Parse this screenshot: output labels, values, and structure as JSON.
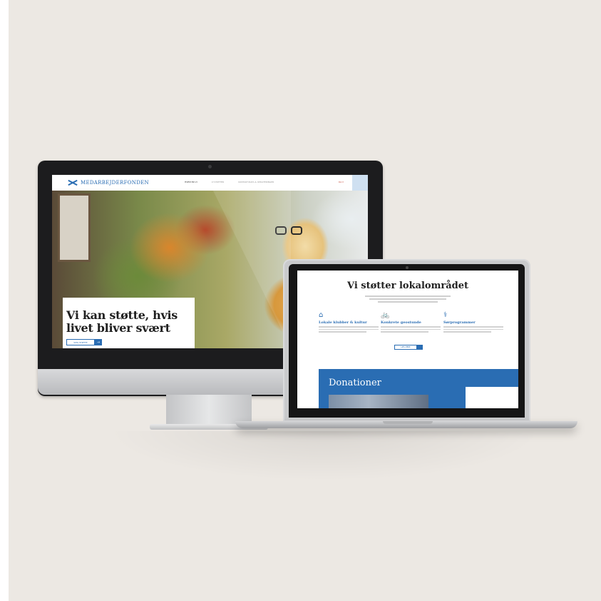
{
  "desktop_site": {
    "logo_text": "MEDARBEJDERFONDEN",
    "nav": {
      "items": [
        "HVEM ER VI",
        "VI STØTTER",
        "KONTAKT/DATA & OPDATERINGER"
      ],
      "language": "DA ▾"
    },
    "hero": {
      "title_line1": "Vi kan støtte, hvis",
      "title_line2": "livet bliver svært",
      "button_label": "SØG STØTTE",
      "button_arrow": "→"
    }
  },
  "laptop_site": {
    "section_title": "Vi støtter lokalområdet",
    "columns": [
      {
        "icon": "⌂",
        "title": "Lokale klubber & kultur"
      },
      {
        "icon": "🚲",
        "title": "Konkrete geostunde"
      },
      {
        "icon": "⚕",
        "title": "Sørprogrammer"
      }
    ],
    "button_label": "LÆS MERE",
    "donations_title": "Donationer"
  },
  "colors": {
    "background": "#ece8e3",
    "brand_blue": "#2a6db3"
  }
}
